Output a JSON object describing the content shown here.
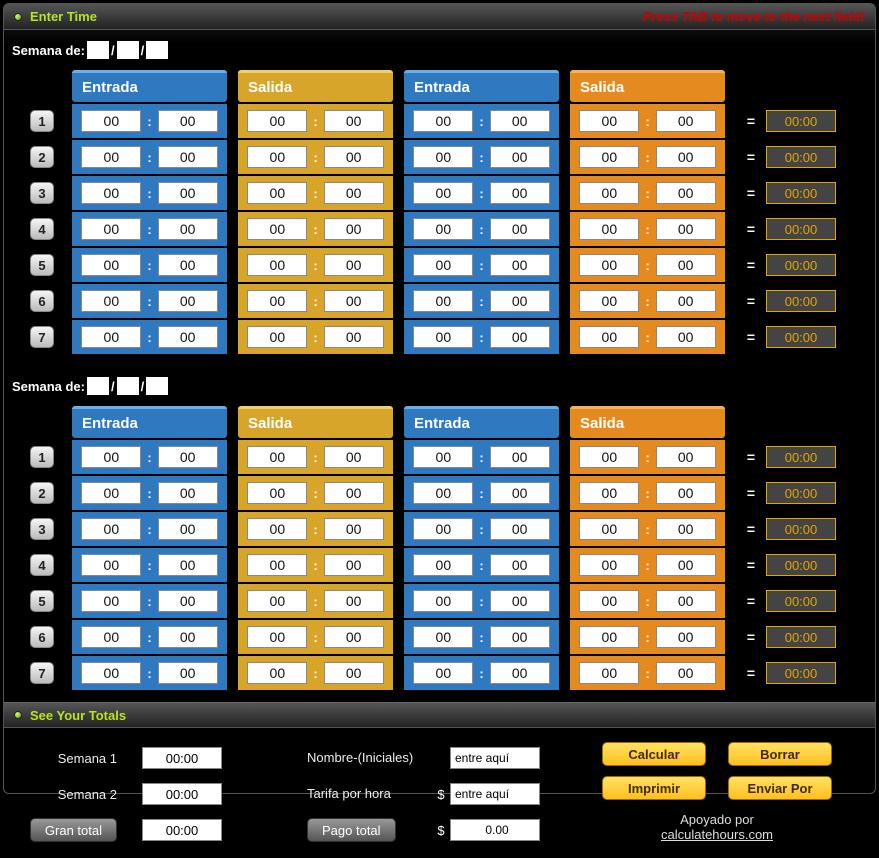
{
  "header": {
    "title": "Enter Time",
    "hint": "Press TAB to move to the next field!"
  },
  "week_label": "Semana de:",
  "columns": [
    "Entrada",
    "Salida",
    "Entrada",
    "Salida"
  ],
  "column_themes": [
    "blue",
    "gold",
    "blue",
    "orange"
  ],
  "equals": "=",
  "colon": ":",
  "weeks": [
    {
      "rows": [
        {
          "num": "1",
          "cells": [
            [
              "00",
              "00"
            ],
            [
              "00",
              "00"
            ],
            [
              "00",
              "00"
            ],
            [
              "00",
              "00"
            ]
          ],
          "total": "00:00"
        },
        {
          "num": "2",
          "cells": [
            [
              "00",
              "00"
            ],
            [
              "00",
              "00"
            ],
            [
              "00",
              "00"
            ],
            [
              "00",
              "00"
            ]
          ],
          "total": "00:00"
        },
        {
          "num": "3",
          "cells": [
            [
              "00",
              "00"
            ],
            [
              "00",
              "00"
            ],
            [
              "00",
              "00"
            ],
            [
              "00",
              "00"
            ]
          ],
          "total": "00:00"
        },
        {
          "num": "4",
          "cells": [
            [
              "00",
              "00"
            ],
            [
              "00",
              "00"
            ],
            [
              "00",
              "00"
            ],
            [
              "00",
              "00"
            ]
          ],
          "total": "00:00"
        },
        {
          "num": "5",
          "cells": [
            [
              "00",
              "00"
            ],
            [
              "00",
              "00"
            ],
            [
              "00",
              "00"
            ],
            [
              "00",
              "00"
            ]
          ],
          "total": "00:00"
        },
        {
          "num": "6",
          "cells": [
            [
              "00",
              "00"
            ],
            [
              "00",
              "00"
            ],
            [
              "00",
              "00"
            ],
            [
              "00",
              "00"
            ]
          ],
          "total": "00:00"
        },
        {
          "num": "7",
          "cells": [
            [
              "00",
              "00"
            ],
            [
              "00",
              "00"
            ],
            [
              "00",
              "00"
            ],
            [
              "00",
              "00"
            ]
          ],
          "total": "00:00"
        }
      ]
    },
    {
      "rows": [
        {
          "num": "1",
          "cells": [
            [
              "00",
              "00"
            ],
            [
              "00",
              "00"
            ],
            [
              "00",
              "00"
            ],
            [
              "00",
              "00"
            ]
          ],
          "total": "00:00"
        },
        {
          "num": "2",
          "cells": [
            [
              "00",
              "00"
            ],
            [
              "00",
              "00"
            ],
            [
              "00",
              "00"
            ],
            [
              "00",
              "00"
            ]
          ],
          "total": "00:00"
        },
        {
          "num": "3",
          "cells": [
            [
              "00",
              "00"
            ],
            [
              "00",
              "00"
            ],
            [
              "00",
              "00"
            ],
            [
              "00",
              "00"
            ]
          ],
          "total": "00:00"
        },
        {
          "num": "4",
          "cells": [
            [
              "00",
              "00"
            ],
            [
              "00",
              "00"
            ],
            [
              "00",
              "00"
            ],
            [
              "00",
              "00"
            ]
          ],
          "total": "00:00"
        },
        {
          "num": "5",
          "cells": [
            [
              "00",
              "00"
            ],
            [
              "00",
              "00"
            ],
            [
              "00",
              "00"
            ],
            [
              "00",
              "00"
            ]
          ],
          "total": "00:00"
        },
        {
          "num": "6",
          "cells": [
            [
              "00",
              "00"
            ],
            [
              "00",
              "00"
            ],
            [
              "00",
              "00"
            ],
            [
              "00",
              "00"
            ]
          ],
          "total": "00:00"
        },
        {
          "num": "7",
          "cells": [
            [
              "00",
              "00"
            ],
            [
              "00",
              "00"
            ],
            [
              "00",
              "00"
            ],
            [
              "00",
              "00"
            ]
          ],
          "total": "00:00"
        }
      ]
    }
  ],
  "totals_header": "See Your Totals",
  "totals": {
    "week1_label": "Semana 1",
    "week1_value": "00:00",
    "week2_label": "Semana 2",
    "week2_value": "00:00",
    "grand_label": "Gran total",
    "grand_value": "00:00",
    "name_label": "Nombre-(Iniciales)",
    "name_placeholder": "entre aquí",
    "rate_label": "Tarifa por hora",
    "rate_placeholder": "entre aquí",
    "pay_label": "Pago total",
    "pay_value": "0.00",
    "currency": "$"
  },
  "actions": {
    "calc": "Calcular",
    "clear": "Borrar",
    "print": "Imprimir",
    "send": "Enviar Por"
  },
  "support": {
    "by": "Apoyado por",
    "link": "calculatehours.com"
  }
}
